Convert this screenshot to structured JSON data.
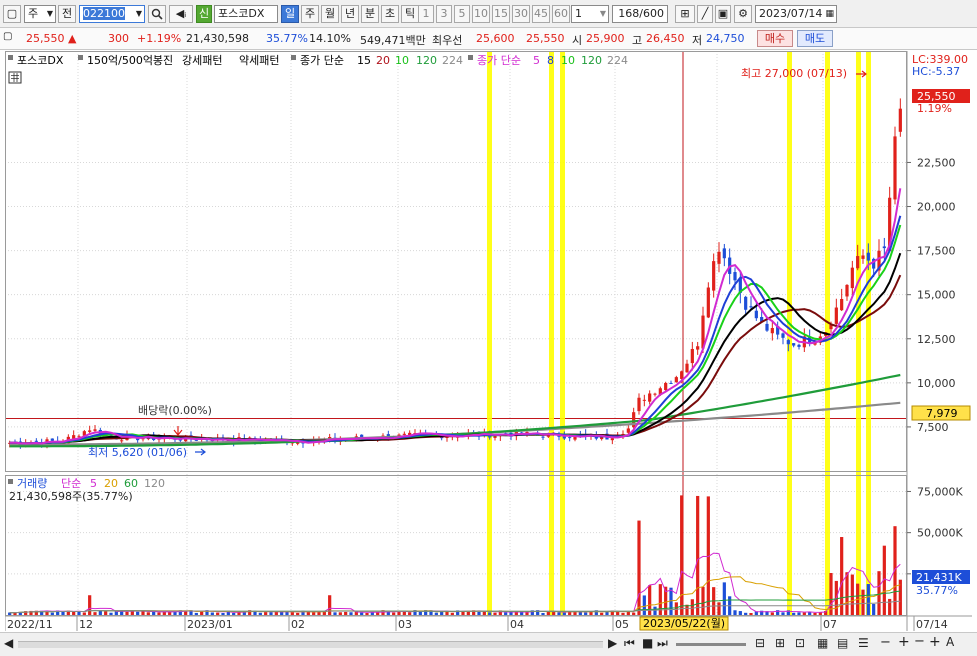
{
  "toolbar": {
    "period_select": "주",
    "prev_label": "전",
    "code": "022100",
    "sin_badge": "신",
    "stock_name": "포스코DX",
    "tabs": [
      "일",
      "주",
      "월",
      "년",
      "분",
      "초",
      "틱"
    ],
    "active_tab": "일",
    "numbers": [
      "1",
      "3",
      "5",
      "10",
      "15",
      "30",
      "45",
      "60"
    ],
    "count_select": "1",
    "count": "168",
    "count_total": "/600",
    "date": "2023/07/14"
  },
  "quote": {
    "price": "25,550",
    "direction": "▲",
    "change": "300",
    "change_pct": "+1.19%",
    "volume": "21,430,598",
    "volume_pct": "35.77%",
    "turnover_pct": "14.10%",
    "amount": "549,471백만",
    "best_label": "최우선",
    "best_ask": "25,600",
    "best_bid": "25,550",
    "open_label": "시",
    "open": "25,900",
    "high_label": "고",
    "high": "26,450",
    "low_label": "저",
    "low": "24,750",
    "buy_label": "매수",
    "sell_label": "매도"
  },
  "legend": {
    "name": "포스코DX",
    "pattern1": "150억/500억봉진",
    "pattern2": "강세패턴",
    "pattern3": "약세패턴",
    "ma_a_label": "종가 단순",
    "ma_a_periods": [
      "15",
      "20",
      "10",
      "120",
      "224"
    ],
    "ma_b_label": "종가 단순",
    "ma_b_periods": [
      "5",
      "8",
      "10",
      "120",
      "224"
    ]
  },
  "price_chart": {
    "lc": "LC:339.00",
    "hc": "HC:-5.37",
    "high_note": "최고 27,000 (07/13)",
    "low_note": "최저 5,620 (01/06)",
    "dividend_note": "배당락(0.00%)",
    "last_price": "25,550",
    "last_pct": "1.19%",
    "hline_price": "7,979",
    "y_ticks": [
      "22,500",
      "20,000",
      "17,500",
      "15,000",
      "12,500",
      "10,000",
      "7,500"
    ]
  },
  "volume_chart": {
    "legend_label": "거래량",
    "ma_label": "단순",
    "ma_periods": [
      "5",
      "20",
      "60",
      "120"
    ],
    "info": "21,430,598주(35.77%)",
    "y_ticks": [
      "75,000K",
      "50,000K",
      "25,000K"
    ],
    "last_volume": "21,431K",
    "last_pct": "35.77%"
  },
  "x_axis": {
    "labels": [
      "2022/11",
      "12",
      "2023/01",
      "02",
      "03",
      "04",
      "05",
      "07",
      "07/14"
    ],
    "cursor_date": "2023/05/22(월)"
  },
  "colors": {
    "up": "#e0211b",
    "down": "#1d4ed8",
    "highlight": "#ffff00",
    "ma5": "#d12ad1",
    "ma8": "#1f3fd6",
    "ma10": "#19d119",
    "ma15": "#000000",
    "ma20": "#7a0c0c",
    "ma120": "#1f9c3a",
    "ma224": "#8a8a8a"
  }
}
